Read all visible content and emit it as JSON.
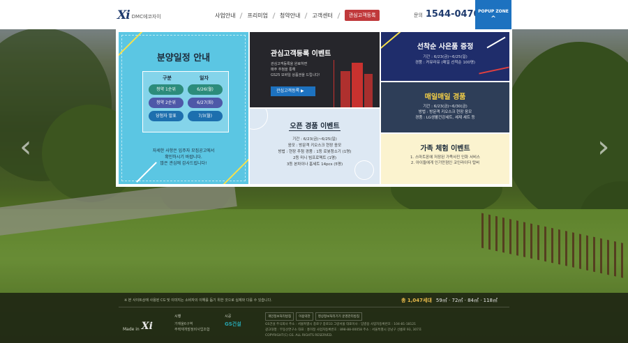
{
  "header": {
    "logo_mark": "Xi",
    "logo_text": "DMC에코자이",
    "menu": [
      "사업안내",
      "프리미엄",
      "청약안내",
      "고객센터"
    ],
    "cta": "관심고객등록",
    "phone_label": "문의",
    "phone_number": "1544-0470",
    "popup_zone": "POPUP ZONE",
    "popup_chevron": "^"
  },
  "popups": {
    "schedule": {
      "title": "분양일정 안내",
      "col_type": "구분",
      "col_date": "일자",
      "rows": [
        {
          "type": "청약 1순위",
          "date": "6/26(월)"
        },
        {
          "type": "청약 2순위",
          "date": "6/27(화)"
        },
        {
          "type": "당첨자 발표",
          "date": "7/3(월)"
        }
      ],
      "note_1": "자세한 사항은 입주자 모집공고에서",
      "note_2": "확인하시기 바랍니다.",
      "note_3": "많은 관심에 감사드립니다!"
    },
    "register": {
      "title": "관심고객등록 이벤트",
      "desc_1": "관심고객등록을 완료하면",
      "desc_2": "매주 추첨을 통해",
      "desc_3": "GS25 모바일 상품권을 드립니다!",
      "button": "관심고객등록 ▶"
    },
    "open": {
      "title": "오픈 경품 이벤트",
      "line_1": "기간 : 6/23(금)~6/25(일)",
      "line_2": "응모 : 방문객 키오스크 현장 응모",
      "line_3": "방법 : 현장 추첨 경품 : 1등 로봇청소기 (1명)",
      "line_4": "2등 미니 빔프로젝트 (1명)",
      "line_5": "3등 본차이나 홈세트 14pcs (5명)"
    },
    "first": {
      "title": "선착순 사은품 증정",
      "line_1": "기간 : 6/23(금)~6/25(일)",
      "line_2": "경품 : 커뮤라유 (매일 선착순 100명)"
    },
    "daily": {
      "title": "매일매일 경품",
      "line_1": "기간 : 6/23(금)~6/30(금)",
      "line_2": "방법 : 방문객 키오스크 현장 응모",
      "line_3": "경품 : LG생활건강세트, 세제 세트 등"
    },
    "family": {
      "title": "가족 체험 이벤트",
      "line_1": "1. 스마트폰에 저장된 가족사진 인화 서비스",
      "line_2": "2. 아이들에게 인기만점인 코인라이더 탑버"
    }
  },
  "slider": {
    "prev": "‹",
    "next": "›"
  },
  "footer": {
    "notice": "※ 본 사이트상에 사용된 CG 및 이미지는 소비자의 이해를 돕기 위한 것으로 실제와 다를 수 있습니다.",
    "total_units": "총 1,047세대",
    "sizes": "59㎡ · 72㎡ · 84㎡ · 118㎡",
    "made_in": "Made in",
    "made_mark": "Xi",
    "developer_head": "시행",
    "developer_1": "가재울6구역",
    "developer_2": "주택재개발정비사업조합",
    "builder_head": "시공",
    "builder": "GS건설",
    "links": [
      "개인정보처리방침",
      "이용약관",
      "영상정보처리기기 운영관리방침"
    ],
    "info_1": "GS건설 주식회사   주소 : 서울특별시 종로구 종로33 그랑서울   대표이사 : 임병용   사업자등록번호 : 104-81-18121",
    "info_2": "광고대행 : 부동산연구소   대표 : 홍미정   사업자등록번호 : 898-88-00058   주소 : 서울특별시 강남구 선릉로 93, 307호",
    "copyright": "COPYRIGHT(C) GS. ALL RIGHTS RESERVED."
  }
}
